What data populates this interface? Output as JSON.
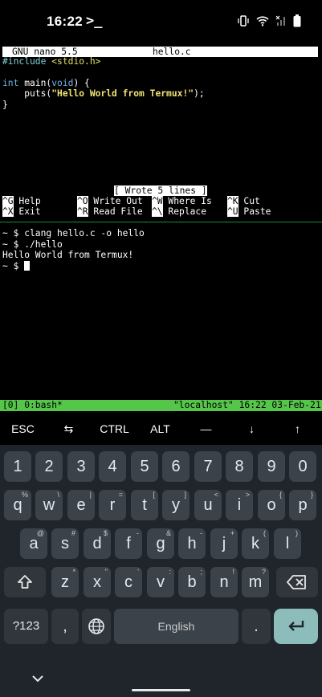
{
  "status_bar": {
    "time": "16:22",
    "terminal_glyph": ">_",
    "icons": [
      "vibrate-icon",
      "wifi-icon",
      "signal-icon",
      "battery-icon"
    ]
  },
  "nano": {
    "title_left": "GNU nano 5.5",
    "title_center": "hello.c",
    "code": {
      "include_kw": "#include",
      "include_hdr": "<stdio.h>",
      "main_type": "int",
      "main_rest": " main(",
      "main_param": "void",
      "main_end": ") {",
      "puts_pre": "    puts(",
      "puts_str": "\"Hello World from Termux!\"",
      "puts_end": ");",
      "close": "}"
    },
    "status_message": "[ Wrote 5 lines ]",
    "shortcuts": [
      {
        "key": "^G",
        "label": "Help"
      },
      {
        "key": "^O",
        "label": "Write Out"
      },
      {
        "key": "^W",
        "label": "Where Is"
      },
      {
        "key": "^K",
        "label": "Cut"
      },
      {
        "key": "^X",
        "label": "Exit"
      },
      {
        "key": "^R",
        "label": "Read File"
      },
      {
        "key": "^\\",
        "label": "Replace"
      },
      {
        "key": "^U",
        "label": "Paste"
      }
    ]
  },
  "shell": {
    "line1": "~ $ clang hello.c -o hello",
    "line2": "~ $ ./hello",
    "line3": "Hello World from Termux!",
    "prompt": "~ $ "
  },
  "tmux": {
    "left": "[0] 0:bash*",
    "right": "\"localhost\" 16:22 03-Feb-21"
  },
  "extra_keys": [
    "ESC",
    "⇆",
    "CTRL",
    "ALT",
    "—",
    "↓",
    "↑"
  ],
  "keyboard": {
    "numbers": [
      "1",
      "2",
      "3",
      "4",
      "5",
      "6",
      "7",
      "8",
      "9",
      "0"
    ],
    "row1": [
      [
        "q",
        "%"
      ],
      [
        "w",
        "\\"
      ],
      [
        "e",
        "|"
      ],
      [
        "r",
        "="
      ],
      [
        "t",
        "["
      ],
      [
        "y",
        "]"
      ],
      [
        "u",
        "<"
      ],
      [
        "i",
        ">"
      ],
      [
        "o",
        "{"
      ],
      [
        "p",
        "}"
      ]
    ],
    "row2": [
      [
        "a",
        "@"
      ],
      [
        "s",
        "#"
      ],
      [
        "d",
        "$"
      ],
      [
        "f",
        "-"
      ],
      [
        "g",
        "&"
      ],
      [
        "h",
        "-"
      ],
      [
        "j",
        "+"
      ],
      [
        "k",
        "("
      ],
      [
        "l",
        ")"
      ]
    ],
    "row3": [
      [
        "z",
        "*"
      ],
      [
        "x",
        "\""
      ],
      [
        "c",
        "'"
      ],
      [
        "v",
        ":"
      ],
      [
        "b",
        ";"
      ],
      [
        "n",
        "!"
      ],
      [
        "m",
        "?"
      ]
    ],
    "symbols_label": "?123",
    "comma": ",",
    "space_label": "English",
    "period": ".",
    "accent": "#8cbdbb"
  }
}
